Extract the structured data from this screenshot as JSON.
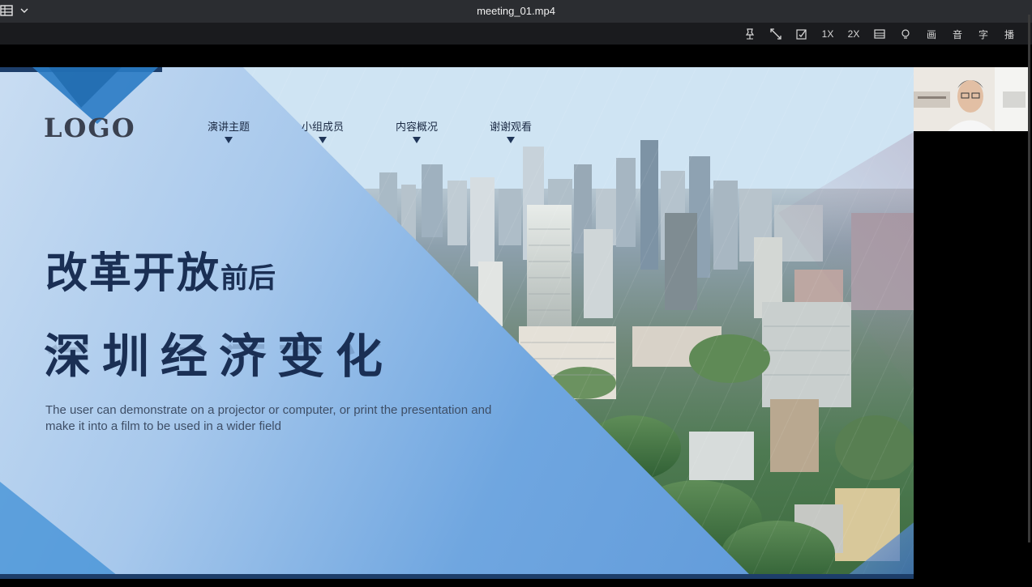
{
  "window": {
    "title": "meeting_01.mp4"
  },
  "toolbar": {
    "items": [
      {
        "name": "pin-icon",
        "label": ""
      },
      {
        "name": "fullscreen-icon",
        "label": ""
      },
      {
        "name": "edit-icon",
        "label": ""
      },
      {
        "name": "speed-1x",
        "label": "1X"
      },
      {
        "name": "speed-2x",
        "label": "2X"
      },
      {
        "name": "layout-icon",
        "label": ""
      },
      {
        "name": "lightbulb-icon",
        "label": ""
      },
      {
        "name": "picture",
        "label": "画"
      },
      {
        "name": "audio",
        "label": "音"
      },
      {
        "name": "subtitle",
        "label": "字"
      },
      {
        "name": "play",
        "label": "播"
      }
    ]
  },
  "slide": {
    "logo": "LOGO",
    "nav": [
      "演讲主题",
      "小组成员",
      "内容概况",
      "谢谢观看"
    ],
    "headline_big": "改革开放",
    "headline_small": "前后",
    "subheadline": "深圳经济变化",
    "description": "The user can demonstrate on a projector or computer, or print the presentation and make it into a film to be used in a wider field"
  },
  "colors": {
    "titlebar": "#2b2d31",
    "toolbar": "#1a1b1e",
    "headline": "#1a2f54"
  }
}
